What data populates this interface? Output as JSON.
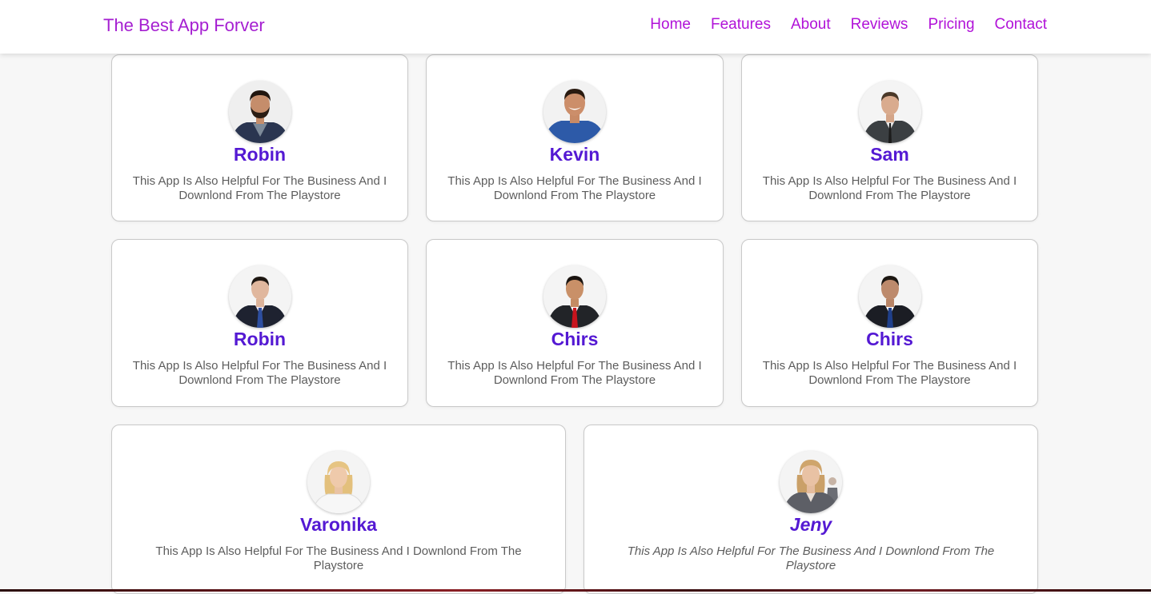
{
  "navbar": {
    "brand": "The Best App Forver",
    "links": [
      "Home",
      "Features",
      "About",
      "Reviews",
      "Pricing",
      "Contact"
    ]
  },
  "colors": {
    "brand": "#a51fd1",
    "nav_link": "#b112d8",
    "name": "#5419d3",
    "text": "#5d5d5d"
  },
  "reviews": [
    {
      "name": "Robin",
      "text": "This App Is Also Helpful For The Business And I Downlond From The Playstore",
      "avatar": "man-bearded-blazer-photo"
    },
    {
      "name": "Kevin",
      "text": "This App Is Also Helpful For The Business And I Downlond From The Playstore",
      "avatar": "man-smiling-blue-shirt-photo"
    },
    {
      "name": "Sam",
      "text": "This App Is Also Helpful For The Business And I Downlond From The Playstore",
      "avatar": "man-grey-suit-photo"
    },
    {
      "name": "Robin",
      "text": "This App Is Also Helpful For The Business And I Downlond From The Playstore",
      "avatar": "man-dark-suit-blue-tie-photo"
    },
    {
      "name": "Chirs",
      "text": "This App Is Also Helpful For The Business And I Downlond From The Playstore",
      "avatar": "man-suit-red-tie-photo"
    },
    {
      "name": "Chirs",
      "text": "This App Is Also Helpful For The Business And I Downlond From The Playstore",
      "avatar": "man-suit-striped-tie-photo"
    },
    {
      "name": "Varonika",
      "text": "This App Is Also Helpful For The Business And I Downlond From The Playstore",
      "avatar": "woman-blonde-white-shirt-photo"
    },
    {
      "name": "Jeny",
      "text": "This App Is Also Helpful For The Business And I Downlond From The Playstore",
      "avatar": "woman-blonde-grey-blazer-photo"
    }
  ]
}
